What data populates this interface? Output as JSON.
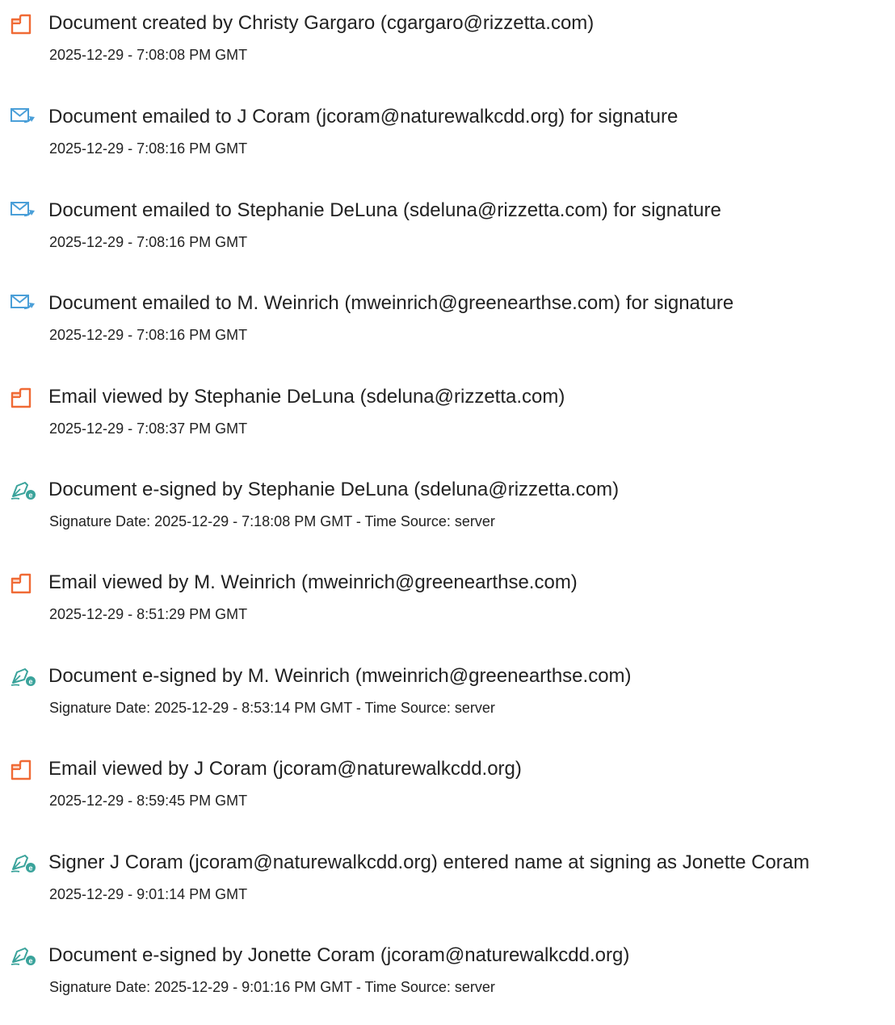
{
  "colors": {
    "doc_icon": "#f06a35",
    "email_icon": "#4a9fd8",
    "sign_icon": "#3aa39b",
    "text": "#222222"
  },
  "entries": [
    {
      "icon": "document-icon",
      "text": "Document created by Christy Gargaro (cgargaro@rizzetta.com)",
      "time": "2025-12-29 - 7:08:08 PM GMT"
    },
    {
      "icon": "email-sent-icon",
      "text": "Document emailed to J Coram (jcoram@naturewalkcdd.org) for signature",
      "time": "2025-12-29 - 7:08:16 PM GMT"
    },
    {
      "icon": "email-sent-icon",
      "text": "Document emailed to Stephanie DeLuna (sdeluna@rizzetta.com) for signature",
      "time": "2025-12-29 - 7:08:16 PM GMT"
    },
    {
      "icon": "email-sent-icon",
      "text": "Document emailed to M. Weinrich (mweinrich@greenearthse.com) for signature",
      "time": "2025-12-29 - 7:08:16 PM GMT"
    },
    {
      "icon": "document-icon",
      "text": "Email viewed by Stephanie DeLuna (sdeluna@rizzetta.com)",
      "time": "2025-12-29 - 7:08:37 PM GMT"
    },
    {
      "icon": "esign-pen-icon",
      "text": "Document e-signed by Stephanie DeLuna (sdeluna@rizzetta.com)",
      "time": "Signature Date: 2025-12-29 - 7:18:08 PM GMT - Time Source: server"
    },
    {
      "icon": "document-icon",
      "text": "Email viewed by M. Weinrich (mweinrich@greenearthse.com)",
      "time": "2025-12-29 - 8:51:29 PM GMT"
    },
    {
      "icon": "esign-pen-icon",
      "text": "Document e-signed by M. Weinrich (mweinrich@greenearthse.com)",
      "time": "Signature Date: 2025-12-29 - 8:53:14 PM GMT - Time Source: server"
    },
    {
      "icon": "document-icon",
      "text": "Email viewed by J Coram (jcoram@naturewalkcdd.org)",
      "time": "2025-12-29 - 8:59:45 PM GMT"
    },
    {
      "icon": "esign-pen-icon",
      "text": "Signer J Coram (jcoram@naturewalkcdd.org) entered name at signing as Jonette Coram",
      "time": "2025-12-29 - 9:01:14 PM GMT"
    },
    {
      "icon": "esign-pen-icon",
      "text": "Document e-signed by Jonette Coram (jcoram@naturewalkcdd.org)",
      "time": "Signature Date: 2025-12-29 - 9:01:16 PM GMT - Time Source: server"
    }
  ]
}
